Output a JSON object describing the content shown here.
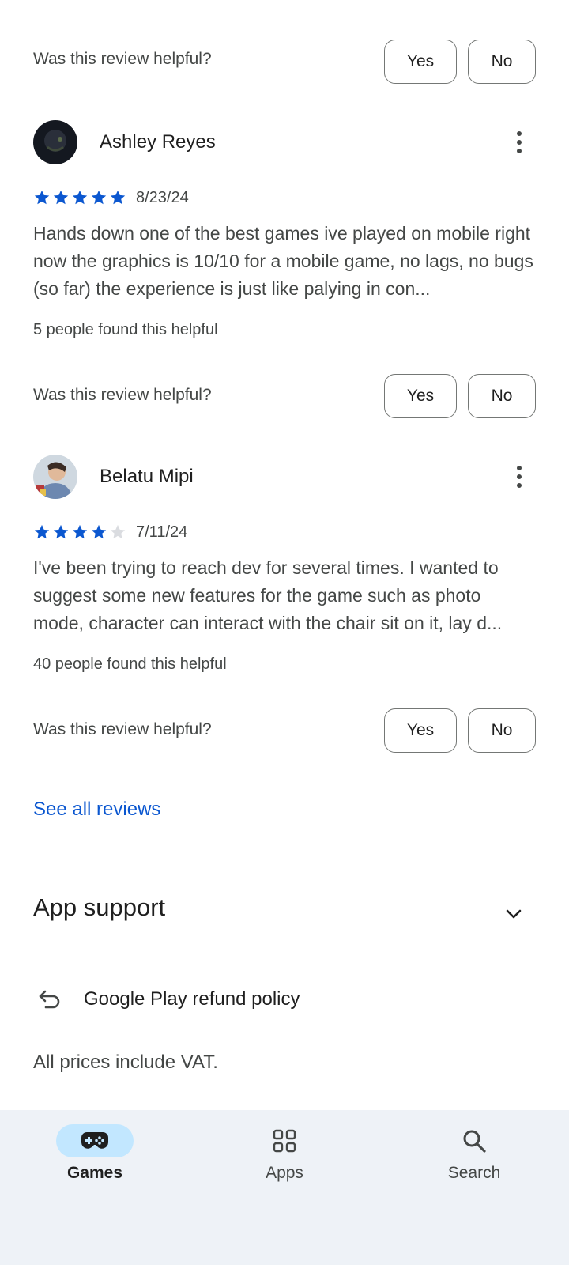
{
  "top_partial": {
    "question": "Was this review helpful?",
    "yes": "Yes",
    "no": "No"
  },
  "reviews": [
    {
      "author": "Ashley Reyes",
      "rating": 5,
      "date": "8/23/24",
      "text": "Hands down one of the best games ive played on mobile right now the graphics is 10/10 for a mobile game, no lags, no bugs (so far) the experience is just like palying in con...",
      "helpful_count": "5 people found this helpful",
      "question": "Was this review helpful?",
      "yes": "Yes",
      "no": "No"
    },
    {
      "author": "Belatu Mipi",
      "rating": 4,
      "date": "7/11/24",
      "text": "I've been trying to reach dev for several times. I wanted to suggest some new features for the game such as photo mode, character can interact with the chair sit on it, lay d...",
      "helpful_count": "40 people found this helpful",
      "question": "Was this review helpful?",
      "yes": "Yes",
      "no": "No"
    }
  ],
  "see_all": "See all reviews",
  "app_support": "App support",
  "refund_policy": "Google Play refund policy",
  "vat": "All prices include VAT.",
  "nav": [
    {
      "label": "Games",
      "icon": "gamepad-icon",
      "active": true
    },
    {
      "label": "Apps",
      "icon": "apps-grid-icon",
      "active": false
    },
    {
      "label": "Search",
      "icon": "search-icon",
      "active": false
    }
  ],
  "colors": {
    "star_filled": "#0b57d0",
    "star_empty": "#dadce0",
    "link": "#0b57d0",
    "nav_bg": "#eef2f7",
    "nav_active_pill": "#c2e7ff"
  }
}
